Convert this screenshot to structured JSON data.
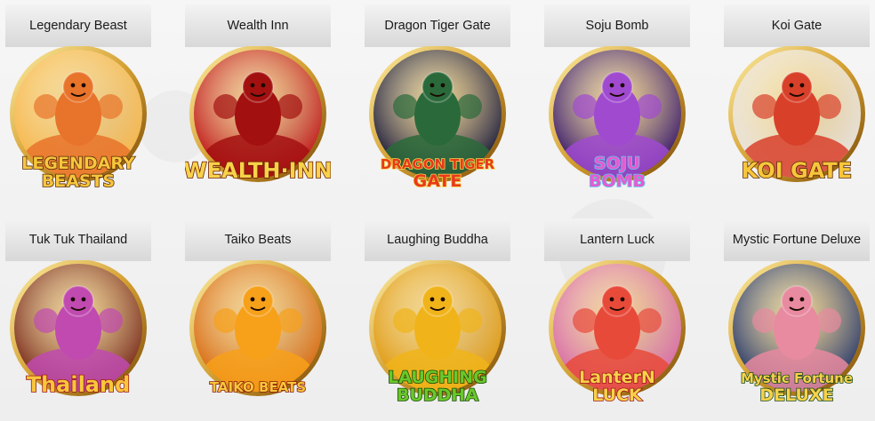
{
  "games": [
    {
      "id": "legendary-beast",
      "title": "Legendary Beast",
      "logo": [
        "LEGENDARY",
        "BEASTS"
      ],
      "colors": {
        "sky": "#f7b64a",
        "ring": "#d4a032",
        "art": "#e8732a",
        "logo": "#f7c63c",
        "stroke": "#5a2a08"
      },
      "icon": "tiger-dragon-phoenix-art"
    },
    {
      "id": "wealth-inn",
      "title": "Wealth Inn",
      "logo": [
        "WEALTH·INN"
      ],
      "colors": {
        "sky": "#c01818",
        "ring": "#d4a032",
        "art": "#a31010",
        "logo": "#f7d24a",
        "stroke": "#6a1a00"
      },
      "icon": "fortune-god-art"
    },
    {
      "id": "dragon-tiger-gate",
      "title": "Dragon Tiger Gate",
      "logo": [
        "DRAGON TIGER",
        "GATE"
      ],
      "colors": {
        "sky": "#1c1c3a",
        "ring": "#d4a032",
        "art": "#2a6a3a",
        "logo": "#e83a1a",
        "stroke": "#f7d24a"
      },
      "icon": "dragon-tiger-art"
    },
    {
      "id": "soju-bomb",
      "title": "Soju Bomb",
      "logo": [
        "SOJU",
        "BOMB"
      ],
      "colors": {
        "sky": "#3a1a6a",
        "ring": "#d4a032",
        "art": "#a04ad0",
        "logo": "#e85ad0",
        "stroke": "#5ac8f0"
      },
      "icon": "neon-girl-art"
    },
    {
      "id": "koi-gate",
      "title": "Koi Gate",
      "logo": [
        "KOI GATE"
      ],
      "colors": {
        "sky": "#e8e2dc",
        "ring": "#d4a032",
        "art": "#d8402a",
        "logo": "#f7c63c",
        "stroke": "#5a2a08"
      },
      "icon": "koi-fish-art"
    },
    {
      "id": "tuk-tuk-thailand",
      "title": "Tuk Tuk Thailand",
      "logo": [
        "Thailand"
      ],
      "colors": {
        "sky": "#7a2a1a",
        "ring": "#d4a032",
        "art": "#c04ab0",
        "logo": "#f7c63c",
        "stroke": "#a01818"
      },
      "icon": "tuk-tuk-art"
    },
    {
      "id": "taiko-beats",
      "title": "Taiko Beats",
      "logo": [
        "TAIKO BEATS"
      ],
      "colors": {
        "sky": "#d86a10",
        "ring": "#d4a032",
        "art": "#f7a01a",
        "logo": "#f7c63c",
        "stroke": "#8a1a08"
      },
      "icon": "taiko-drum-art"
    },
    {
      "id": "laughing-buddha",
      "title": "Laughing Buddha",
      "logo": [
        "LAUGHING",
        "BUDDHA"
      ],
      "colors": {
        "sky": "#e09a10",
        "ring": "#d4a032",
        "art": "#f0b41a",
        "logo": "#6ac82a",
        "stroke": "#1a4a08"
      },
      "icon": "buddha-art"
    },
    {
      "id": "lantern-luck",
      "title": "Lantern Luck",
      "logo": [
        "LanterN",
        "LUCK"
      ],
      "colors": {
        "sky": "#d86aa8",
        "ring": "#d4a032",
        "art": "#e84a3a",
        "logo": "#f7d24a",
        "stroke": "#a01818"
      },
      "icon": "lantern-art"
    },
    {
      "id": "mystic-fortune-deluxe",
      "title": "Mystic Fortune Deluxe",
      "logo": [
        "Mystic Fortune",
        "DELUXE"
      ],
      "colors": {
        "sky": "#2a3a6a",
        "ring": "#d4a032",
        "art": "#e88aa0",
        "logo": "#f7d24a",
        "stroke": "#1a4a1a"
      },
      "icon": "mystic-lady-art"
    }
  ]
}
